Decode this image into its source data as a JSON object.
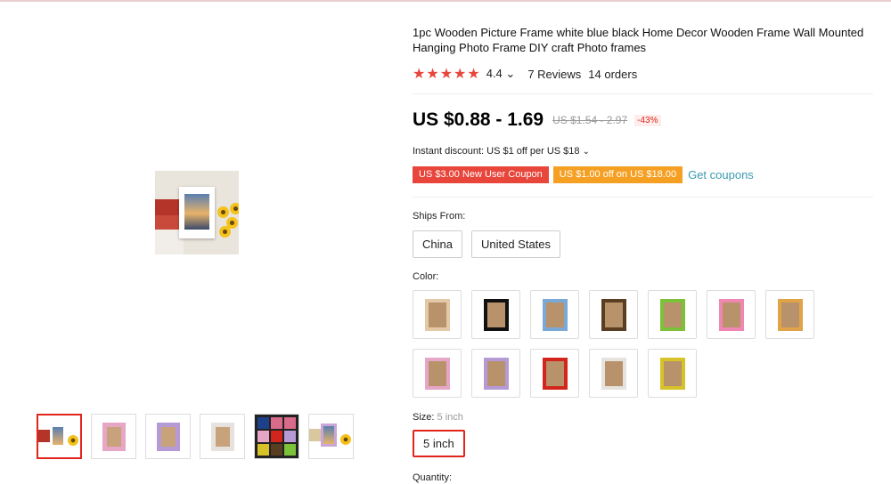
{
  "product": {
    "title": "1pc Wooden Picture Frame white blue black Home Decor Wooden Frame Wall Mounted Hanging Photo Frame DIY craft Photo frames",
    "stars": "★★★★★",
    "rating": "4.4",
    "reviews": "7 Reviews",
    "orders": "14 orders"
  },
  "pricing": {
    "price": "US $0.88 - 1.69",
    "old_price": "US $1.54 - 2.97",
    "discount": "-43%",
    "instant_discount": "Instant discount: US $1 off per US $18",
    "coupon_new_user": "US $3.00 New User Coupon",
    "coupon_off": "US $1.00 off on US $18.00",
    "get_coupons": "Get coupons"
  },
  "shipping": {
    "label": "Ships From:",
    "options": [
      "China",
      "United States"
    ]
  },
  "color": {
    "label": "Color:",
    "swatches": [
      "#e3c9a6",
      "#111111",
      "#7aa9d6",
      "#5a3e22",
      "#7cc13a",
      "#ef87b2",
      "#e0a348",
      "#e6a6c6",
      "#b59ad6",
      "#d2261c",
      "#e6e2de",
      "#d8c22a"
    ]
  },
  "size": {
    "label": "Size:",
    "selected_value": "5 inch",
    "option": "5 inch"
  },
  "quantity": {
    "label": "Quantity:"
  },
  "gallery": {
    "thumb_colors": [
      "#e6a6c6",
      "#b59ad6",
      "#e6e2de"
    ]
  }
}
